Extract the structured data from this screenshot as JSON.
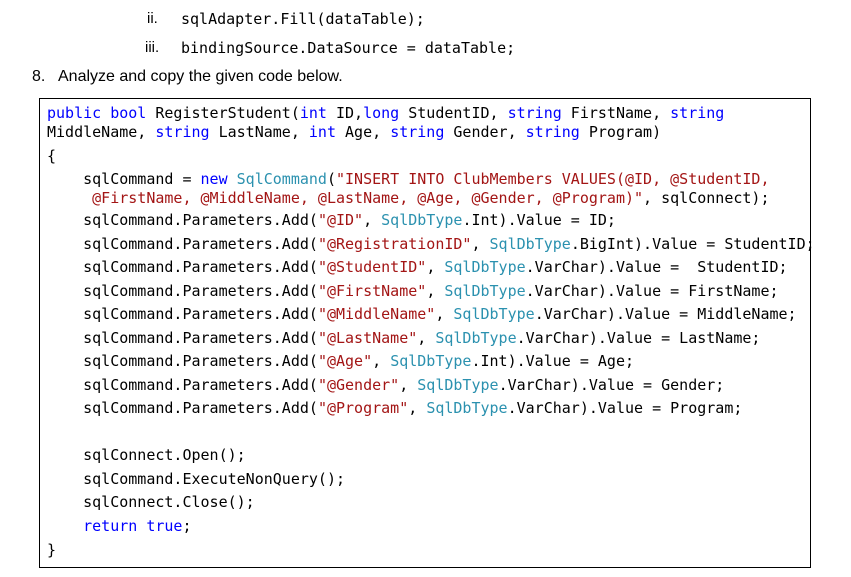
{
  "preceding_items": [
    {
      "numeral": "ii.",
      "code": "sqlAdapter.Fill(dataTable);"
    },
    {
      "numeral": "iii.",
      "code": "bindingSource.DataSource = dataTable;"
    }
  ],
  "item": {
    "number": "8.",
    "text": "Analyze and copy the given code below."
  },
  "code": {
    "sig1": {
      "a": "public",
      "b": " ",
      "c": "bool",
      "d": " RegisterStudent(",
      "e": "int",
      "f": " ID,",
      "g": "long",
      "h": " StudentID, ",
      "i": "string",
      "j": " FirstName, ",
      "k": "string"
    },
    "sig2": {
      "a": "MiddleName, ",
      "b": "string",
      "c": " LastName, ",
      "d": "int",
      "e": " Age, ",
      "f": "string",
      "g": " Gender, ",
      "h": "string",
      "i": " Program)"
    },
    "open_brace": "{",
    "cmd1": {
      "a": "    sqlCommand = ",
      "b": "new",
      "c": " ",
      "d": "SqlCommand",
      "e": "(",
      "f": "\"INSERT INTO ClubMembers VALUES(@ID, @StudentID,"
    },
    "cmd2": {
      "a": "     ",
      "b": "@FirstName, @MiddleName, @LastName, @Age, @Gender, @Program)\"",
      "c": ", sqlConnect);"
    },
    "params": [
      {
        "pre": "    sqlCommand.Parameters.Add(",
        "str": "\"@ID\"",
        "mid": ", ",
        "type": "SqlDbType",
        "post": ".Int).Value = ID;"
      },
      {
        "pre": "    sqlCommand.Parameters.Add(",
        "str": "\"@RegistrationID\"",
        "mid": ", ",
        "type": "SqlDbType",
        "post": ".BigInt).Value = StudentID;"
      },
      {
        "pre": "    sqlCommand.Parameters.Add(",
        "str": "\"@StudentID\"",
        "mid": ", ",
        "type": "SqlDbType",
        "post": ".VarChar).Value =  StudentID;"
      },
      {
        "pre": "    sqlCommand.Parameters.Add(",
        "str": "\"@FirstName\"",
        "mid": ", ",
        "type": "SqlDbType",
        "post": ".VarChar).Value = FirstName;"
      },
      {
        "pre": "    sqlCommand.Parameters.Add(",
        "str": "\"@MiddleName\"",
        "mid": ", ",
        "type": "SqlDbType",
        "post": ".VarChar).Value = MiddleName;"
      },
      {
        "pre": "    sqlCommand.Parameters.Add(",
        "str": "\"@LastName\"",
        "mid": ", ",
        "type": "SqlDbType",
        "post": ".VarChar).Value = LastName;"
      },
      {
        "pre": "    sqlCommand.Parameters.Add(",
        "str": "\"@Age\"",
        "mid": ", ",
        "type": "SqlDbType",
        "post": ".Int).Value = Age;"
      },
      {
        "pre": "    sqlCommand.Parameters.Add(",
        "str": "\"@Gender\"",
        "mid": ", ",
        "type": "SqlDbType",
        "post": ".VarChar).Value = Gender;"
      },
      {
        "pre": "    sqlCommand.Parameters.Add(",
        "str": "\"@Program\"",
        "mid": ", ",
        "type": "SqlDbType",
        "post": ".VarChar).Value = Program;"
      }
    ],
    "open_call": "    sqlConnect.Open();",
    "exec_call": "    sqlCommand.ExecuteNonQuery();",
    "close_call": "    sqlConnect.Close();",
    "ret": {
      "a": "    ",
      "b": "return",
      "c": " ",
      "d": "true",
      "e": ";"
    },
    "close_brace": "}"
  },
  "colors": {
    "keyword": "#0000ff",
    "type": "#2b91af",
    "string": "#a31515",
    "text": "#000000",
    "border": "#000000"
  }
}
